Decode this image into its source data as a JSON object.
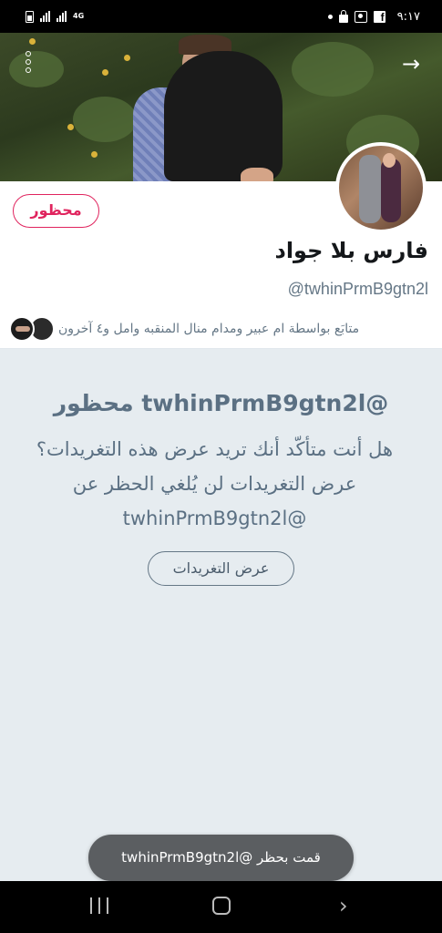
{
  "status_bar": {
    "network": "4G",
    "time": "٩:١٧",
    "icons": [
      "battery-icon",
      "signal-icon",
      "signal-icon",
      "lte-icon",
      "dot-icon",
      "lock-icon",
      "screenshot-icon",
      "facebook-icon"
    ]
  },
  "header": {
    "menu_icon": "more-vertical-icon",
    "forward_icon": "arrow-right-icon",
    "forward_glyph": "→"
  },
  "profile": {
    "blocked_label": "محظور",
    "display_name": "فارس بلا جواد",
    "handle": "@twhinPrmB9gtn2l",
    "followed_by": "متابَع بواسطة ام عبير ومدام منال المنقبه وامل و٤ آخرون"
  },
  "blocked_panel": {
    "title": "@twhinPrmB9gtn2l محظور",
    "body": "هل أنت متأكّد أنك تريد عرض هذه التغريدات؟ عرض التغريدات لن يُلغي الحظر عن @twhinPrmB9gtn2l",
    "view_button": "عرض التغريدات"
  },
  "toast": {
    "message": "قمت بحظر @twhinPrmB9gtn2l"
  },
  "nav_bar": {
    "recents_icon": "recents-icon",
    "home_icon": "home-icon",
    "back_icon": "back-icon",
    "back_glyph": "›"
  },
  "colors": {
    "accent_blocked": "#e0245e",
    "muted_text": "#657786",
    "panel_bg": "#e6ecf0"
  }
}
